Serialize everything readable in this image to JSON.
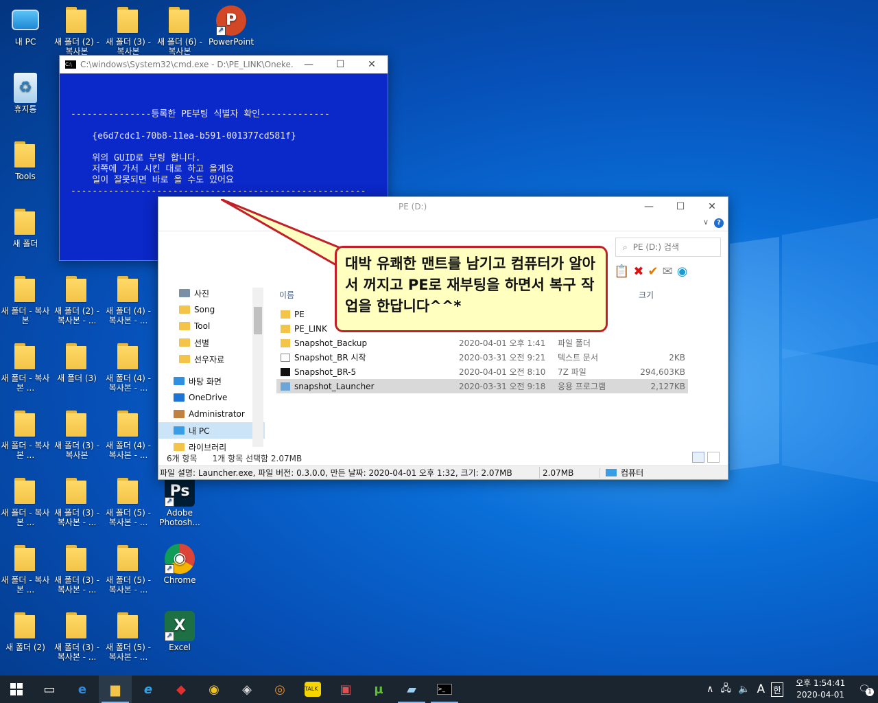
{
  "desktop": {
    "icons": [
      {
        "label": "내 PC",
        "kind": "pc"
      },
      {
        "label": "새 폴더 (2) - 복사본",
        "kind": "folder"
      },
      {
        "label": "새 폴더 (3) - 복사본",
        "kind": "folder"
      },
      {
        "label": "새 폴더 (6) - 복사본",
        "kind": "folder"
      },
      {
        "label": "PowerPoint",
        "kind": "app"
      },
      {
        "label": "휴지통",
        "kind": "recycle"
      },
      {
        "label": "Tools",
        "kind": "folder"
      },
      {
        "label": "새 폴더",
        "kind": "folder"
      },
      {
        "label": "새 폴더 - 복사본",
        "kind": "folder"
      },
      {
        "label": "새 폴더 (2) - 복사본 - ...",
        "kind": "folder"
      },
      {
        "label": "새 폴더 (4) - 복사본 - ...",
        "kind": "folder"
      },
      {
        "label": "새 폴더 - 복사본 ...",
        "kind": "folder"
      },
      {
        "label": "새 폴더 (3)",
        "kind": "folder"
      },
      {
        "label": "새 폴더 (4) - 복사본 - ...",
        "kind": "folder"
      },
      {
        "label": "새 폴더 - 복사본 ...",
        "kind": "folder"
      },
      {
        "label": "새 폴더 (3) - 복사본",
        "kind": "folder"
      },
      {
        "label": "새 폴더 (4) - 복사본 - ...",
        "kind": "folder"
      },
      {
        "label": "새 폴더 - 복사본 ...",
        "kind": "folder"
      },
      {
        "label": "새 폴더 (3) - 복사본 - ...",
        "kind": "folder"
      },
      {
        "label": "새 폴더 (5) - 복사본 - ...",
        "kind": "folder"
      },
      {
        "label": "Adobe Photosh...",
        "kind": "app"
      },
      {
        "label": "새 폴더 - 복사본 ...",
        "kind": "folder"
      },
      {
        "label": "새 폴더 (3) - 복사본 - ...",
        "kind": "folder"
      },
      {
        "label": "새 폴더 (5) - 복사본 - ...",
        "kind": "folder"
      },
      {
        "label": "Chrome",
        "kind": "app"
      },
      {
        "label": "새 폴더 (2)",
        "kind": "folder"
      },
      {
        "label": "새 폴더 (3) - 복사본 - ...",
        "kind": "folder"
      },
      {
        "label": "새 폴더 (5) - 복사본 - ...",
        "kind": "folder"
      },
      {
        "label": "Excel",
        "kind": "app"
      }
    ]
  },
  "cmd": {
    "title": "C:\\windows\\System32\\cmd.exe - D:\\PE_LINK\\Oneke...",
    "lines": [
      "",
      "",
      "",
      "---------------등록한 PE부팅 식별자 확인-------------",
      "",
      "    {e6d7cdc1-70b8-11ea-b591-001377cd581f}",
      "",
      "    위의 GUID로 부팅 합니다.",
      "    저쪽에 가서 시킨 대로 하고 올게요",
      "    일이 잘못되면 바로 올 수도 있어요",
      "-------------------------------------------------------"
    ]
  },
  "callout": {
    "text": "대박 유쾌한 맨트를 남기고 컴퓨터가 알아서 꺼지고 PE로 재부팅을 하면서 복구 작업을 한답니다^^*"
  },
  "explorer": {
    "title": "PE (D:)",
    "search_placeholder": "PE (D:) 검색",
    "nav": [
      {
        "label": "사진",
        "color": "#7a8fa6"
      },
      {
        "label": "Song",
        "color": "#f3c447"
      },
      {
        "label": "Tool",
        "color": "#f3c447"
      },
      {
        "label": "선별",
        "color": "#f3c447"
      },
      {
        "label": "선우자료",
        "color": "#f3c447"
      },
      {
        "label": "바탕 화면",
        "color": "#2f8fe0"
      },
      {
        "label": "OneDrive",
        "color": "#1e73d6"
      },
      {
        "label": "Administrator",
        "color": "#c08040"
      },
      {
        "label": "내 PC",
        "color": "#3a9ee6"
      },
      {
        "label": "라이브러리",
        "color": "#f3c447"
      }
    ],
    "columns": {
      "name": "이름",
      "size": "크기"
    },
    "files": [
      {
        "name": "PE",
        "date": "",
        "type": "",
        "size": "",
        "icon": "folder"
      },
      {
        "name": "PE_LINK",
        "date": "",
        "type": "",
        "size": "",
        "icon": "folder"
      },
      {
        "name": "Snapshot_Backup",
        "date": "2020-04-01 오후 1:41",
        "type": "파일 폴더",
        "size": "",
        "icon": "folder"
      },
      {
        "name": "Snapshot_BR 시작",
        "date": "2020-03-31 오전 9:21",
        "type": "텍스트 문서",
        "size": "2KB",
        "icon": "text"
      },
      {
        "name": "Snapshot_BR-5",
        "date": "2020-04-01 오전 8:10",
        "type": "7Z 파일",
        "size": "294,603KB",
        "icon": "7z"
      },
      {
        "name": "snapshot_Launcher",
        "date": "2020-03-31 오전 9:18",
        "type": "응용 프로그램",
        "size": "2,127KB",
        "icon": "exe"
      }
    ],
    "item_count": "6개 항목",
    "selection": "1개 항목 선택함 2.07MB",
    "status": {
      "description": "파일 설명: Launcher.exe, 파일 버전: 0.3.0.0, 만든 날짜: 2020-04-01 오후 1:32, 크기: 2.07MB",
      "size": "2.07MB",
      "location": "컴퓨터"
    }
  },
  "taskbar": {
    "apps": [
      "start-icon",
      "task-view-icon",
      "edge-icon",
      "file-explorer-icon",
      "ie-icon",
      "app-icon",
      "chrome-icon",
      "tool-icon",
      "eye-icon",
      "kakaotalk-icon",
      "app2-icon",
      "utorrent-icon",
      "notepad-icon",
      "cmd-icon"
    ],
    "ime": "A",
    "ime2": "한",
    "time": "오후 1:54:41",
    "date": "2020-04-01",
    "notification_count": "1"
  }
}
